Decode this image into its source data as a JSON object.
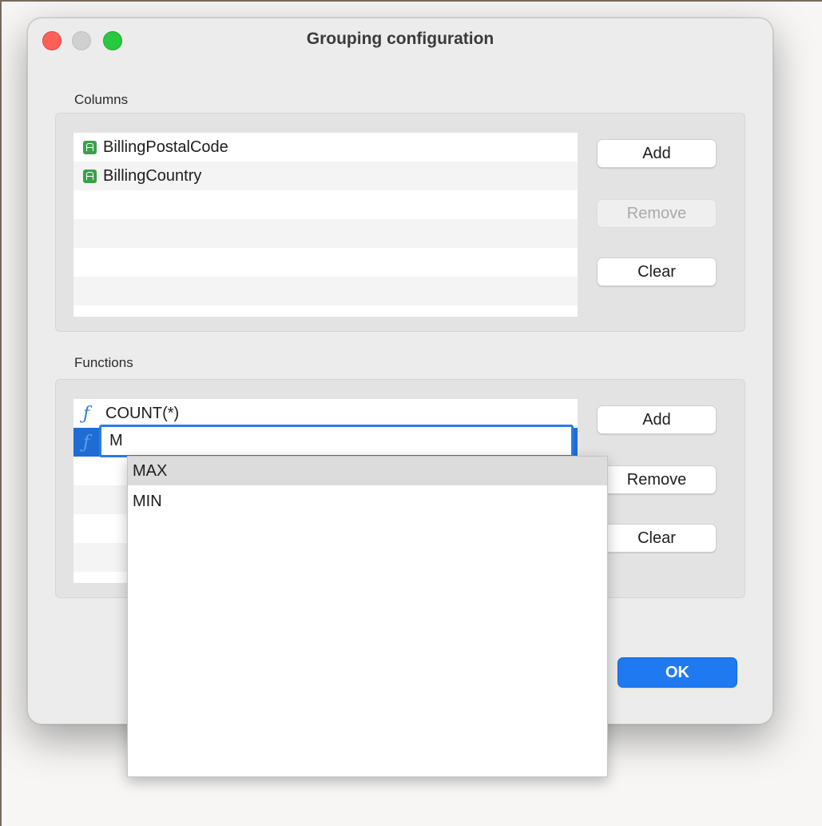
{
  "window": {
    "title": "Grouping configuration"
  },
  "columns_section": {
    "label": "Columns",
    "items": [
      {
        "name": "BillingPostalCode",
        "icon": "text-column-icon"
      },
      {
        "name": "BillingCountry",
        "icon": "text-column-icon"
      }
    ],
    "buttons": {
      "add": "Add",
      "remove": "Remove",
      "clear": "Clear"
    }
  },
  "functions_section": {
    "label": "Functions",
    "items": [
      {
        "name": "COUNT(*)",
        "icon": "function-icon"
      }
    ],
    "editing_value": "M",
    "buttons": {
      "add": "Add",
      "remove": "Remove",
      "clear": "Clear"
    }
  },
  "autocomplete": {
    "options": [
      "MAX",
      "MIN"
    ],
    "highlighted": "MAX"
  },
  "footer": {
    "ok_label": "OK"
  },
  "colors": {
    "accent": "#1f79f0",
    "selection": "#1f6cd4",
    "column_icon": "#3aa14a",
    "function_icon": "#2a7fd0"
  }
}
